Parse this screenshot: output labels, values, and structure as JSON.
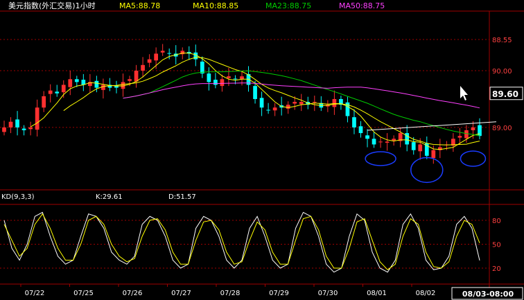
{
  "header": {
    "title": "美元指数(外汇交易)1小时",
    "ma5": "MA5:88.78",
    "ma10": "MA10:88.85",
    "ma23": "MA23:88.75",
    "ma50": "MA50:88.75"
  },
  "kd_header": {
    "label": "KD(9,3,3)",
    "k": "K:29.61",
    "d": "D:51.57"
  },
  "price_box": {
    "current": "89.60"
  },
  "footer_box": {
    "text": "08/03-08:00"
  },
  "colors": {
    "title": "#ffffff",
    "ma5": "#ffff00",
    "ma10": "#ffff00",
    "ma23": "#00cc00",
    "ma50": "#ff40ff",
    "up": "#ff3030",
    "down": "#00ffff",
    "grid": "#a00000",
    "k_line": "#ffffff",
    "d_line": "#ffff00",
    "circle": "#1a3cff"
  },
  "chart_data": [
    {
      "type": "candlestick",
      "title": "美元指数(外汇交易)1小时",
      "x_labels": [
        "07/22",
        "07/25",
        "07/26",
        "07/27",
        "07/28",
        "07/29",
        "07/30",
        "08/01",
        "08/02"
      ],
      "ylim": [
        87.9,
        91.05
      ],
      "yticks": [
        {
          "value": 90.55,
          "label": "88.55"
        },
        {
          "value": 90.0,
          "label": "90.00"
        },
        {
          "value": 89.0,
          "label": "89.00"
        }
      ],
      "current_price": 89.6,
      "closes": [
        89.0,
        89.1,
        89.0,
        88.95,
        89.0,
        89.35,
        89.55,
        89.65,
        89.6,
        89.75,
        89.85,
        89.8,
        89.75,
        89.8,
        89.7,
        89.75,
        89.7,
        89.7,
        89.8,
        89.85,
        90.0,
        90.1,
        90.2,
        90.3,
        90.35,
        90.3,
        90.25,
        90.35,
        90.3,
        90.2,
        89.95,
        89.8,
        89.75,
        89.85,
        89.9,
        89.85,
        89.9,
        89.75,
        89.5,
        89.35,
        89.3,
        89.35,
        89.35,
        89.4,
        89.45,
        89.45,
        89.4,
        89.45,
        89.35,
        89.4,
        89.5,
        89.4,
        89.2,
        89.0,
        88.9,
        88.8,
        88.7,
        88.75,
        88.75,
        88.8,
        88.9,
        88.7,
        88.6,
        88.7,
        88.5,
        88.6,
        88.65,
        88.7,
        88.8,
        88.85,
        88.95,
        89.0,
        88.85
      ],
      "ma_periods": [
        5,
        10,
        23,
        50
      ]
    },
    {
      "type": "line",
      "title": "KD(9,3,3)",
      "ylim": [
        0,
        100
      ],
      "yticks": [
        80,
        50,
        20
      ],
      "series": [
        {
          "name": "K",
          "values": [
            80,
            45,
            30,
            50,
            85,
            90,
            60,
            35,
            25,
            30,
            60,
            88,
            85,
            70,
            40,
            30,
            25,
            35,
            75,
            85,
            80,
            60,
            30,
            20,
            25,
            70,
            85,
            80,
            60,
            30,
            20,
            30,
            70,
            85,
            60,
            30,
            20,
            25,
            70,
            90,
            85,
            60,
            25,
            15,
            20,
            60,
            88,
            80,
            40,
            20,
            15,
            30,
            75,
            88,
            70,
            30,
            18,
            20,
            35,
            75,
            85,
            70,
            29.61
          ]
        },
        {
          "name": "D",
          "values": [
            75,
            55,
            35,
            45,
            75,
            88,
            70,
            45,
            30,
            30,
            50,
            80,
            85,
            75,
            50,
            35,
            28,
            32,
            60,
            80,
            82,
            68,
            40,
            25,
            25,
            55,
            78,
            80,
            68,
            40,
            25,
            28,
            55,
            78,
            68,
            40,
            25,
            25,
            55,
            82,
            85,
            68,
            35,
            20,
            20,
            45,
            78,
            82,
            55,
            28,
            18,
            25,
            60,
            82,
            75,
            40,
            22,
            20,
            28,
            60,
            80,
            75,
            51.57
          ]
        }
      ],
      "current_k": 29.61,
      "current_d": 51.57
    }
  ]
}
